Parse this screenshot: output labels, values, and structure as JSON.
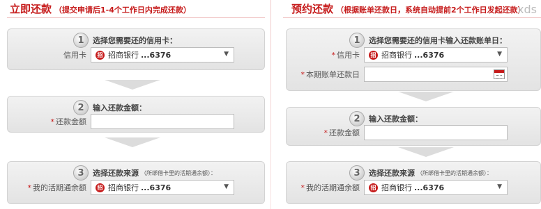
{
  "left": {
    "title": "立即还款",
    "subtitle": "（提交申请后1-4个工作日内完成还款）",
    "step1": {
      "num": "1",
      "title": "选择您需要还的信用卡：",
      "card_label": "信用卡",
      "bank": "招商银行",
      "card_no": "...6376"
    },
    "step2": {
      "num": "2",
      "title": "输入还款金额：",
      "amount_label": "还款金额",
      "amount_value": ""
    },
    "step3": {
      "num": "3",
      "title": "选择还款来源",
      "note": "（所绑借卡里的活期通余额）：",
      "source_label": "我的活期通余额",
      "bank": "招商银行",
      "card_no": "...6376"
    }
  },
  "right": {
    "title": "预约还款",
    "subtitle": "（根据账单还款日，系统自动提前2个工作日发起还款）",
    "step1": {
      "num": "1",
      "title": "选择您需要还的信用卡输入还款账单日：",
      "card_label": "信用卡",
      "bank": "招商银行",
      "card_no": "...6376",
      "due_label": "本期账单还款日",
      "due_value": ""
    },
    "step2": {
      "num": "2",
      "title": "输入还款金额：",
      "amount_label": "还款金额",
      "amount_value": ""
    },
    "step3": {
      "num": "3",
      "title": "选择还款来源",
      "note": "（所绑借卡里的活期通余额）：",
      "source_label": "我的活期通余额",
      "bank": "招商银行",
      "card_no": "...6376"
    }
  },
  "watermark": "xds",
  "icons": {
    "bank": "cmb-logo-icon",
    "dropdown": "chevron-down-icon",
    "calendar": "calendar-icon"
  },
  "colors": {
    "accent": "#c61b1b",
    "panel": "#e8e8e8"
  }
}
